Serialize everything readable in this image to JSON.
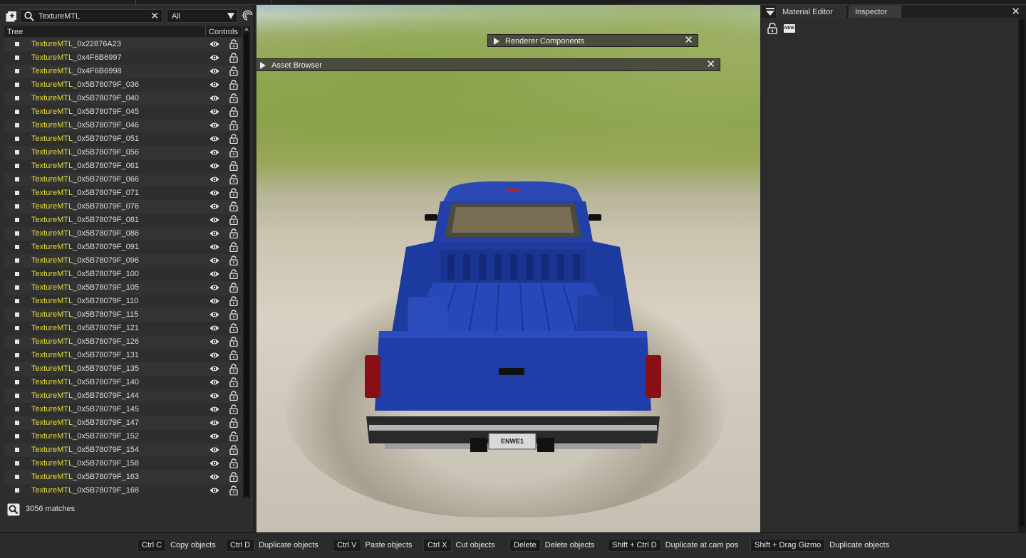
{
  "scene_tree": {
    "search_value": "TextureMTL",
    "filter_value": "All",
    "column_tree": "Tree",
    "column_controls": "Controls",
    "highlight": "TextureMTL",
    "items": [
      {
        "prefix": "TextureMTL",
        "suffix": "_0x22876A23"
      },
      {
        "prefix": "TextureMTL",
        "suffix": "_0x4F6B6997"
      },
      {
        "prefix": "TextureMTL",
        "suffix": "_0x4F6B6998"
      },
      {
        "prefix": "TextureMTL",
        "suffix": "_0x5B78079F_036"
      },
      {
        "prefix": "TextureMTL",
        "suffix": "_0x5B78079F_040"
      },
      {
        "prefix": "TextureMTL",
        "suffix": "_0x5B78079F_045"
      },
      {
        "prefix": "TextureMTL",
        "suffix": "_0x5B78079F_046"
      },
      {
        "prefix": "TextureMTL",
        "suffix": "_0x5B78079F_051"
      },
      {
        "prefix": "TextureMTL",
        "suffix": "_0x5B78079F_056"
      },
      {
        "prefix": "TextureMTL",
        "suffix": "_0x5B78079F_061"
      },
      {
        "prefix": "TextureMTL",
        "suffix": "_0x5B78079F_066"
      },
      {
        "prefix": "TextureMTL",
        "suffix": "_0x5B78079F_071"
      },
      {
        "prefix": "TextureMTL",
        "suffix": "_0x5B78079F_076"
      },
      {
        "prefix": "TextureMTL",
        "suffix": "_0x5B78079F_081"
      },
      {
        "prefix": "TextureMTL",
        "suffix": "_0x5B78079F_086"
      },
      {
        "prefix": "TextureMTL",
        "suffix": "_0x5B78079F_091"
      },
      {
        "prefix": "TextureMTL",
        "suffix": "_0x5B78079F_096"
      },
      {
        "prefix": "TextureMTL",
        "suffix": "_0x5B78079F_100"
      },
      {
        "prefix": "TextureMTL",
        "suffix": "_0x5B78079F_105"
      },
      {
        "prefix": "TextureMTL",
        "suffix": "_0x5B78079F_110"
      },
      {
        "prefix": "TextureMTL",
        "suffix": "_0x5B78079F_115"
      },
      {
        "prefix": "TextureMTL",
        "suffix": "_0x5B78079F_121"
      },
      {
        "prefix": "TextureMTL",
        "suffix": "_0x5B78079F_126"
      },
      {
        "prefix": "TextureMTL",
        "suffix": "_0x5B78079F_131"
      },
      {
        "prefix": "TextureMTL",
        "suffix": "_0x5B78079F_135"
      },
      {
        "prefix": "TextureMTL",
        "suffix": "_0x5B78079F_140"
      },
      {
        "prefix": "TextureMTL",
        "suffix": "_0x5B78079F_144"
      },
      {
        "prefix": "TextureMTL",
        "suffix": "_0x5B78079F_145"
      },
      {
        "prefix": "TextureMTL",
        "suffix": "_0x5B78079F_147"
      },
      {
        "prefix": "TextureMTL",
        "suffix": "_0x5B78079F_152"
      },
      {
        "prefix": "TextureMTL",
        "suffix": "_0x5B78079F_154"
      },
      {
        "prefix": "TextureMTL",
        "suffix": "_0x5B78079F_158"
      },
      {
        "prefix": "TextureMTL",
        "suffix": "_0x5B78079F_163"
      },
      {
        "prefix": "TextureMTL",
        "suffix": "_0x5B78079F_168"
      }
    ],
    "matches_text": "3056 matches"
  },
  "viewport": {
    "renderer_components_label": "Renderer Components",
    "asset_browser_label": "Asset Browser",
    "license_plate": "ENWE1"
  },
  "inspector": {
    "tab_material_editor": "Material Editor",
    "tab_inspector": "Inspector",
    "new_badge": "NEW"
  },
  "shortcuts": [
    {
      "key": "Ctrl C",
      "desc": "Copy objects"
    },
    {
      "key": "Ctrl D",
      "desc": "Duplicate objects"
    },
    {
      "key": "Ctrl V",
      "desc": "Paste objects"
    },
    {
      "key": "Ctrl X",
      "desc": "Cut objects"
    },
    {
      "key": "Delete",
      "desc": "Delete objects"
    },
    {
      "key": "Shift + Ctrl D",
      "desc": "Duplicate at cam pos"
    },
    {
      "key": "Shift + Drag Gizmo",
      "desc": "Duplicate objects"
    }
  ],
  "colors": {
    "highlight": "#e8df3a",
    "panel": "#2d2d2d",
    "truck_blue": "#1f3fa8"
  },
  "icons": [
    "add-object-icon",
    "search-icon",
    "close-icon",
    "dropdown-arrow-icon",
    "radar-icon",
    "eye-icon",
    "lock-icon",
    "zoom-search-icon",
    "menu-icon",
    "play-icon"
  ]
}
